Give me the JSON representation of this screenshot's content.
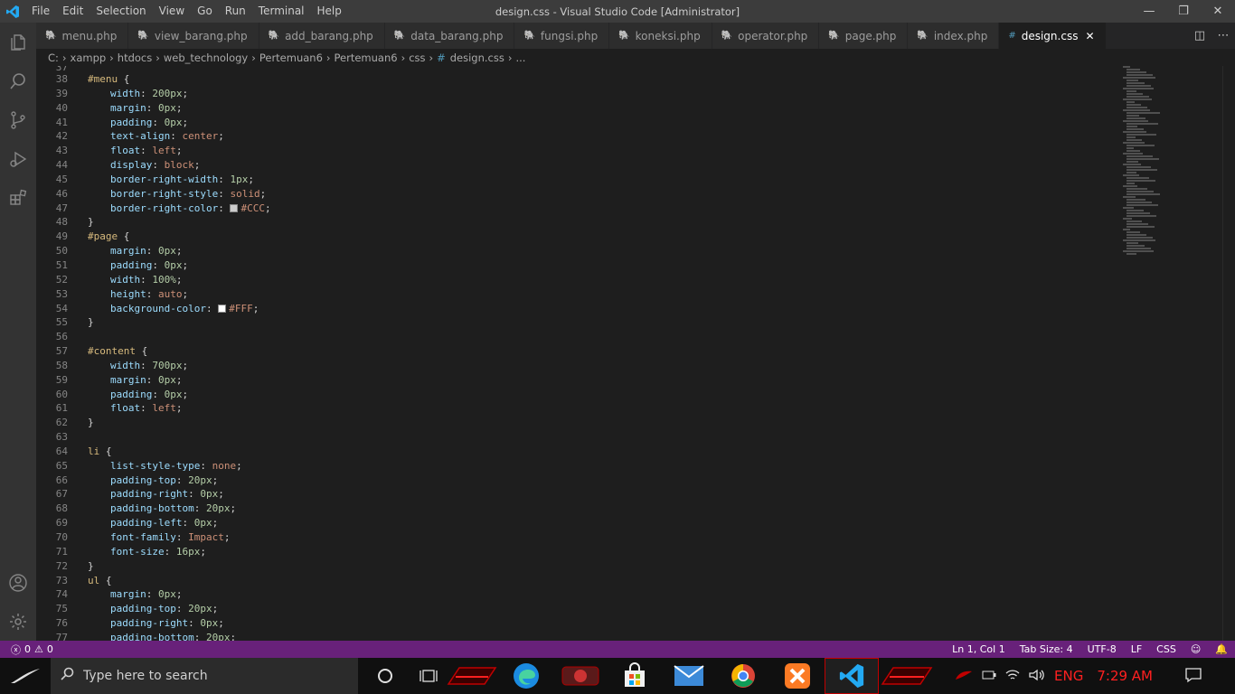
{
  "window": {
    "title": "design.css - Visual Studio Code [Administrator]",
    "menu": [
      "File",
      "Edit",
      "Selection",
      "View",
      "Go",
      "Run",
      "Terminal",
      "Help"
    ],
    "buttons": {
      "minimize": "—",
      "maximize": "❐",
      "close": "✕"
    }
  },
  "colors": {
    "accent": "#007acc",
    "statusbar": "#68217a",
    "tab_active": "#1e1e1e",
    "selector": "#d7ba7d",
    "property": "#9cdcfe",
    "number": "#b5cea8",
    "value": "#ce9178"
  },
  "tabs": [
    {
      "label": "menu.php",
      "icon": "php-elephant-icon",
      "active": false
    },
    {
      "label": "view_barang.php",
      "icon": "php-elephant-icon",
      "active": false
    },
    {
      "label": "add_barang.php",
      "icon": "php-elephant-icon",
      "active": false
    },
    {
      "label": "data_barang.php",
      "icon": "php-elephant-icon",
      "active": false
    },
    {
      "label": "fungsi.php",
      "icon": "php-elephant-icon",
      "active": false
    },
    {
      "label": "koneksi.php",
      "icon": "php-elephant-icon",
      "active": false
    },
    {
      "label": "operator.php",
      "icon": "php-elephant-icon",
      "active": false
    },
    {
      "label": "page.php",
      "icon": "php-elephant-icon",
      "active": false
    },
    {
      "label": "index.php",
      "icon": "php-elephant-icon",
      "active": false
    },
    {
      "label": "design.css",
      "icon": "css-hash-icon",
      "active": true
    }
  ],
  "breadcrumb": [
    "C:",
    "xampp",
    "htdocs",
    "web_technology",
    "Pertemuan6",
    "Pertemuan6",
    "css",
    "design.css",
    "..."
  ],
  "code": {
    "first_line_partial": "37",
    "lines": [
      {
        "n": "38",
        "parts": [
          [
            "sel",
            "#menu"
          ],
          [
            "pun",
            " {"
          ]
        ]
      },
      {
        "n": "39",
        "indent": true,
        "parts": [
          [
            "prop",
            "width"
          ],
          [
            "pun",
            ": "
          ],
          [
            "num",
            "200px"
          ],
          [
            "pun",
            ";"
          ]
        ]
      },
      {
        "n": "40",
        "indent": true,
        "parts": [
          [
            "prop",
            "margin"
          ],
          [
            "pun",
            ": "
          ],
          [
            "num",
            "0px"
          ],
          [
            "pun",
            ";"
          ]
        ]
      },
      {
        "n": "41",
        "indent": true,
        "parts": [
          [
            "prop",
            "padding"
          ],
          [
            "pun",
            ": "
          ],
          [
            "num",
            "0px"
          ],
          [
            "pun",
            ";"
          ]
        ]
      },
      {
        "n": "42",
        "indent": true,
        "parts": [
          [
            "prop",
            "text-align"
          ],
          [
            "pun",
            ": "
          ],
          [
            "kw",
            "center"
          ],
          [
            "pun",
            ";"
          ]
        ]
      },
      {
        "n": "43",
        "indent": true,
        "parts": [
          [
            "prop",
            "float"
          ],
          [
            "pun",
            ": "
          ],
          [
            "kw",
            "left"
          ],
          [
            "pun",
            ";"
          ]
        ]
      },
      {
        "n": "44",
        "indent": true,
        "parts": [
          [
            "prop",
            "display"
          ],
          [
            "pun",
            ": "
          ],
          [
            "kw",
            "block"
          ],
          [
            "pun",
            ";"
          ]
        ]
      },
      {
        "n": "45",
        "indent": true,
        "parts": [
          [
            "prop",
            "border-right-width"
          ],
          [
            "pun",
            ": "
          ],
          [
            "num",
            "1px"
          ],
          [
            "pun",
            ";"
          ]
        ]
      },
      {
        "n": "46",
        "indent": true,
        "parts": [
          [
            "prop",
            "border-right-style"
          ],
          [
            "pun",
            ": "
          ],
          [
            "kw",
            "solid"
          ],
          [
            "pun",
            ";"
          ]
        ]
      },
      {
        "n": "47",
        "indent": true,
        "parts": [
          [
            "prop",
            "border-right-color"
          ],
          [
            "pun",
            ": "
          ],
          [
            "swatch",
            "#CCCCCC"
          ],
          [
            "kw",
            "#CCC"
          ],
          [
            "pun",
            ";"
          ]
        ]
      },
      {
        "n": "48",
        "parts": [
          [
            "pun",
            "}"
          ]
        ]
      },
      {
        "n": "49",
        "parts": [
          [
            "sel",
            "#page"
          ],
          [
            "pun",
            " {"
          ]
        ]
      },
      {
        "n": "50",
        "indent": true,
        "parts": [
          [
            "prop",
            "margin"
          ],
          [
            "pun",
            ": "
          ],
          [
            "num",
            "0px"
          ],
          [
            "pun",
            ";"
          ]
        ]
      },
      {
        "n": "51",
        "indent": true,
        "parts": [
          [
            "prop",
            "padding"
          ],
          [
            "pun",
            ": "
          ],
          [
            "num",
            "0px"
          ],
          [
            "pun",
            ";"
          ]
        ]
      },
      {
        "n": "52",
        "indent": true,
        "parts": [
          [
            "prop",
            "width"
          ],
          [
            "pun",
            ": "
          ],
          [
            "num",
            "100%"
          ],
          [
            "pun",
            ";"
          ]
        ]
      },
      {
        "n": "53",
        "indent": true,
        "parts": [
          [
            "prop",
            "height"
          ],
          [
            "pun",
            ": "
          ],
          [
            "kw",
            "auto"
          ],
          [
            "pun",
            ";"
          ]
        ]
      },
      {
        "n": "54",
        "indent": true,
        "parts": [
          [
            "prop",
            "background-color"
          ],
          [
            "pun",
            ": "
          ],
          [
            "swatch",
            "#FFFFFF"
          ],
          [
            "kw",
            "#FFF"
          ],
          [
            "pun",
            ";"
          ]
        ]
      },
      {
        "n": "55",
        "parts": [
          [
            "pun",
            "}"
          ]
        ]
      },
      {
        "n": "56",
        "parts": []
      },
      {
        "n": "57",
        "parts": [
          [
            "sel",
            "#content"
          ],
          [
            "pun",
            " {"
          ]
        ]
      },
      {
        "n": "58",
        "indent": true,
        "parts": [
          [
            "prop",
            "width"
          ],
          [
            "pun",
            ": "
          ],
          [
            "num",
            "700px"
          ],
          [
            "pun",
            ";"
          ]
        ]
      },
      {
        "n": "59",
        "indent": true,
        "parts": [
          [
            "prop",
            "margin"
          ],
          [
            "pun",
            ": "
          ],
          [
            "num",
            "0px"
          ],
          [
            "pun",
            ";"
          ]
        ]
      },
      {
        "n": "60",
        "indent": true,
        "parts": [
          [
            "prop",
            "padding"
          ],
          [
            "pun",
            ": "
          ],
          [
            "num",
            "0px"
          ],
          [
            "pun",
            ";"
          ]
        ]
      },
      {
        "n": "61",
        "indent": true,
        "parts": [
          [
            "prop",
            "float"
          ],
          [
            "pun",
            ": "
          ],
          [
            "kw",
            "left"
          ],
          [
            "pun",
            ";"
          ]
        ]
      },
      {
        "n": "62",
        "parts": [
          [
            "pun",
            "}"
          ]
        ]
      },
      {
        "n": "63",
        "parts": []
      },
      {
        "n": "64",
        "parts": [
          [
            "sel",
            "li"
          ],
          [
            "pun",
            " {"
          ]
        ]
      },
      {
        "n": "65",
        "indent": true,
        "parts": [
          [
            "prop",
            "list-style-type"
          ],
          [
            "pun",
            ": "
          ],
          [
            "kw",
            "none"
          ],
          [
            "pun",
            ";"
          ]
        ]
      },
      {
        "n": "66",
        "indent": true,
        "parts": [
          [
            "prop",
            "padding-top"
          ],
          [
            "pun",
            ": "
          ],
          [
            "num",
            "20px"
          ],
          [
            "pun",
            ";"
          ]
        ]
      },
      {
        "n": "67",
        "indent": true,
        "parts": [
          [
            "prop",
            "padding-right"
          ],
          [
            "pun",
            ": "
          ],
          [
            "num",
            "0px"
          ],
          [
            "pun",
            ";"
          ]
        ]
      },
      {
        "n": "68",
        "indent": true,
        "parts": [
          [
            "prop",
            "padding-bottom"
          ],
          [
            "pun",
            ": "
          ],
          [
            "num",
            "20px"
          ],
          [
            "pun",
            ";"
          ]
        ]
      },
      {
        "n": "69",
        "indent": true,
        "parts": [
          [
            "prop",
            "padding-left"
          ],
          [
            "pun",
            ": "
          ],
          [
            "num",
            "0px"
          ],
          [
            "pun",
            ";"
          ]
        ]
      },
      {
        "n": "70",
        "indent": true,
        "parts": [
          [
            "prop",
            "font-family"
          ],
          [
            "pun",
            ": "
          ],
          [
            "kw",
            "Impact"
          ],
          [
            "pun",
            ";"
          ]
        ]
      },
      {
        "n": "71",
        "indent": true,
        "parts": [
          [
            "prop",
            "font-size"
          ],
          [
            "pun",
            ": "
          ],
          [
            "num",
            "16px"
          ],
          [
            "pun",
            ";"
          ]
        ]
      },
      {
        "n": "72",
        "parts": [
          [
            "pun",
            "}"
          ]
        ]
      },
      {
        "n": "73",
        "parts": [
          [
            "sel",
            "ul"
          ],
          [
            "pun",
            " {"
          ]
        ]
      },
      {
        "n": "74",
        "indent": true,
        "parts": [
          [
            "prop",
            "margin"
          ],
          [
            "pun",
            ": "
          ],
          [
            "num",
            "0px"
          ],
          [
            "pun",
            ";"
          ]
        ]
      },
      {
        "n": "75",
        "indent": true,
        "parts": [
          [
            "prop",
            "padding-top"
          ],
          [
            "pun",
            ": "
          ],
          [
            "num",
            "20px"
          ],
          [
            "pun",
            ";"
          ]
        ]
      },
      {
        "n": "76",
        "indent": true,
        "parts": [
          [
            "prop",
            "padding-right"
          ],
          [
            "pun",
            ": "
          ],
          [
            "num",
            "0px"
          ],
          [
            "pun",
            ";"
          ]
        ]
      },
      {
        "n": "77",
        "indent": true,
        "parts": [
          [
            "prop",
            "padding-bottom"
          ],
          [
            "pun",
            ": "
          ],
          [
            "num",
            "20px"
          ],
          [
            "pun",
            ";"
          ]
        ]
      }
    ]
  },
  "statusbar": {
    "errors": "0",
    "warnings": "0",
    "position": "Ln 1, Col 1",
    "tab_size": "Tab Size: 4",
    "encoding": "UTF-8",
    "eol": "LF",
    "language": "CSS"
  },
  "taskbar": {
    "search_placeholder": "Type here to search",
    "language": "ENG",
    "clock": "7:29 AM"
  }
}
